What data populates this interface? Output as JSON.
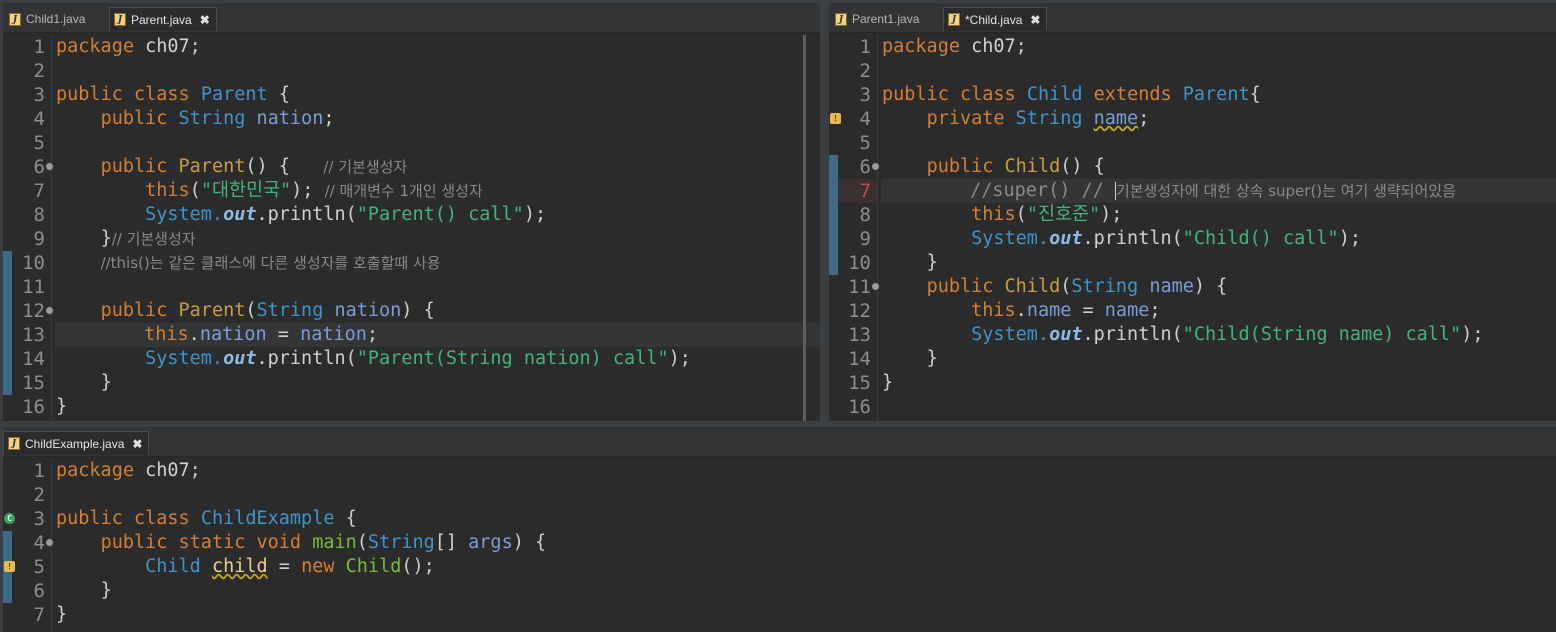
{
  "left_pane": {
    "tabs": [
      {
        "label": "Child1.java"
      },
      {
        "label": "Parent.java",
        "close": "✖"
      }
    ]
  },
  "right_pane": {
    "tabs": [
      {
        "label": "Parent1.java"
      },
      {
        "label": "*Child.java",
        "close": "✖"
      }
    ]
  },
  "bottom_pane": {
    "tabs": [
      {
        "label": "ChildExample.java",
        "close": "✖"
      }
    ]
  },
  "parent_code": {
    "l1": [
      "package",
      "ch07;"
    ],
    "l3": [
      "public",
      "class",
      "Parent",
      "{"
    ],
    "l4": [
      "public",
      "String",
      "nation",
      ";"
    ],
    "l6": [
      "public",
      "Parent",
      "() {",
      "// 기본생성자"
    ],
    "l7": [
      "this",
      "(",
      "\"대한민국\"",
      ");",
      "// 매개변수 1개인 생성자"
    ],
    "l8": [
      "System.",
      "out",
      ".println(",
      "\"Parent() call\"",
      ");"
    ],
    "l9": [
      "}",
      "// 기본생성자"
    ],
    "l10": [
      "//this()는 같은 클래스에 다른 생성자를 호출할때 사용"
    ],
    "l12": [
      "public",
      "Parent",
      "(",
      "String",
      "nation",
      ") {"
    ],
    "l13": [
      "this",
      ".",
      "nation",
      " = ",
      "nation",
      ";"
    ],
    "l14": [
      "System.",
      "out",
      ".println(",
      "\"Parent(String nation) call\"",
      ");"
    ],
    "l15": [
      "}"
    ],
    "l16": [
      "}"
    ]
  },
  "child_code": {
    "l1": [
      "package",
      "ch07;"
    ],
    "l3": [
      "public",
      "class",
      "Child",
      "extends",
      "Parent",
      "{"
    ],
    "l4": [
      "private",
      "String",
      "name",
      ";"
    ],
    "l6": [
      "public",
      "Child",
      "() {"
    ],
    "l7": [
      "//super() //",
      "기본생성자에 대한 상속 super()는 여기 생략되어있음"
    ],
    "l8": [
      "this",
      "(",
      "\"진호준\"",
      ");"
    ],
    "l9": [
      "System.",
      "out",
      ".println(",
      "\"Child() call\"",
      ");"
    ],
    "l10": [
      "}"
    ],
    "l11": [
      "public",
      "Child",
      "(",
      "String",
      "name",
      ") {"
    ],
    "l12": [
      "this",
      ".",
      "name",
      " = ",
      "name",
      ";"
    ],
    "l13": [
      "System.",
      "out",
      ".println(",
      "\"Child(String name) call\"",
      ");"
    ],
    "l14": [
      "}"
    ],
    "l15": [
      "}"
    ]
  },
  "example_code": {
    "l1": [
      "package",
      "ch07;"
    ],
    "l3": [
      "public",
      "class",
      "ChildExample",
      "{"
    ],
    "l4": [
      "public",
      "static",
      "void",
      "main",
      "(",
      "String",
      "[] ",
      "args",
      ") {"
    ],
    "l5": [
      "Child",
      "child",
      " = ",
      "new",
      "Child",
      "();"
    ],
    "l6": [
      "}"
    ],
    "l7": [
      "}"
    ]
  },
  "line_numbers": {
    "parent": [
      "1",
      "2",
      "3",
      "4",
      "5",
      "6",
      "7",
      "8",
      "9",
      "10",
      "11",
      "12",
      "13",
      "14",
      "15",
      "16"
    ],
    "child": [
      "1",
      "2",
      "3",
      "4",
      "5",
      "6",
      "7",
      "8",
      "9",
      "10",
      "11",
      "12",
      "13",
      "14",
      "15",
      "16"
    ],
    "example": [
      "1",
      "2",
      "3",
      "4",
      "5",
      "6",
      "7"
    ]
  },
  "colors": {
    "keyword": "#d77e2f",
    "type": "#3d95cf",
    "string": "#3fb77a",
    "comment": "#8a8a8a",
    "background": "#2b2b2b"
  }
}
